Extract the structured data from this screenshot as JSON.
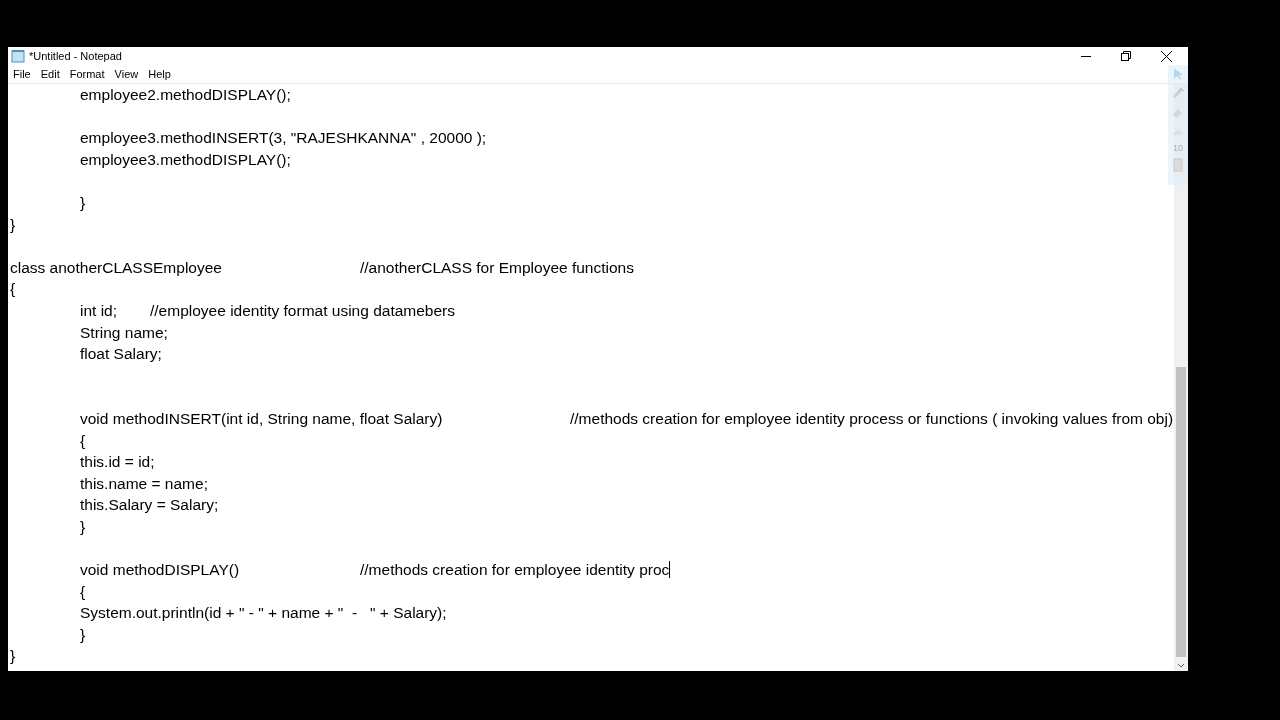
{
  "window": {
    "title": "*Untitled - Notepad"
  },
  "menu": [
    "File",
    "Edit",
    "Format",
    "View",
    "Help"
  ],
  "editor": {
    "lines": [
      {
        "kind": "text",
        "text": "\temployee2.methodDISPLAY();"
      },
      {
        "kind": "blank"
      },
      {
        "kind": "text",
        "text": "\temployee3.methodINSERT(3, \"RAJESHKANNA\" , 20000 );"
      },
      {
        "kind": "text",
        "text": "\temployee3.methodDISPLAY();"
      },
      {
        "kind": "blank"
      },
      {
        "kind": "text",
        "text": "\t}"
      },
      {
        "kind": "text",
        "text": "}"
      },
      {
        "kind": "blank"
      },
      {
        "kind": "text",
        "text": "class anotherCLASSEmployee\t\t//anotherCLASS for Employee functions"
      },
      {
        "kind": "text",
        "text": "{"
      },
      {
        "kind": "text",
        "text": "\tint id;\t//employee identity format using datamebers"
      },
      {
        "kind": "text",
        "text": "\tString name;"
      },
      {
        "kind": "text",
        "text": "\tfloat Salary;"
      },
      {
        "kind": "blank"
      },
      {
        "kind": "blank"
      },
      {
        "kind": "text",
        "text": "\tvoid methodINSERT(int id, String name, float Salary)\t\t//methods creation for employee identity process or functions ( invoking values from obj)"
      },
      {
        "kind": "text",
        "text": "\t{"
      },
      {
        "kind": "text",
        "text": "\tthis.id = id;"
      },
      {
        "kind": "text",
        "text": "\tthis.name = name;"
      },
      {
        "kind": "text",
        "text": "\tthis.Salary = Salary;"
      },
      {
        "kind": "text",
        "text": "\t}"
      },
      {
        "kind": "blank"
      },
      {
        "kind": "text",
        "text": "\tvoid methodDISPLAY()\t\t//methods creation for employee identity proc",
        "caret": true
      },
      {
        "kind": "text",
        "text": "\t{"
      },
      {
        "kind": "text",
        "text": "\tSystem.out.println(id + \" - \" + name + \"  -   \" + Salary);"
      },
      {
        "kind": "text",
        "text": "\t}"
      },
      {
        "kind": "text",
        "text": "}"
      }
    ]
  },
  "overlay_toolbar": {
    "size": "10"
  }
}
